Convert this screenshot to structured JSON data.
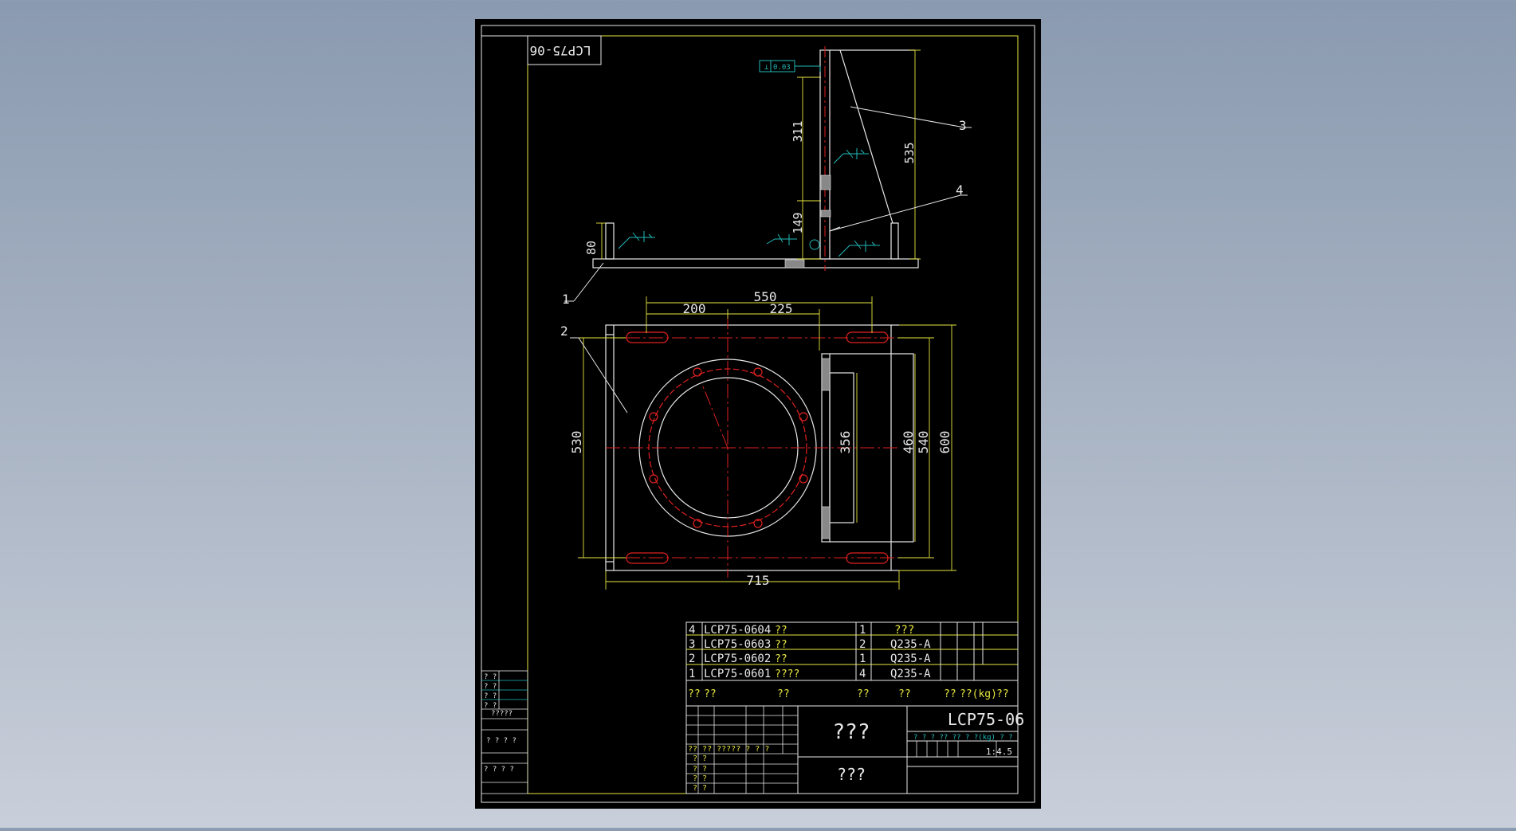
{
  "drawing": {
    "title_rot": "LCP75-06",
    "dims": {
      "d311": "311",
      "d535": "535",
      "d149": "149",
      "d80": "80",
      "d550": "550",
      "d200": "200",
      "d225": "225",
      "d530": "530",
      "d356": "356",
      "d460": "460",
      "d540": "540",
      "d600": "600",
      "d715": "715"
    },
    "flatness": "0.03",
    "leaders": {
      "l1": "1",
      "l2": "2",
      "l3": "3",
      "l4": "4"
    },
    "bom": [
      {
        "no": "4",
        "code": "LCP75-0604",
        "qty": "1",
        "mat": "???"
      },
      {
        "no": "3",
        "code": "LCP75-0603",
        "qty": "2",
        "mat": "Q235-A"
      },
      {
        "no": "2",
        "code": "LCP75-0602",
        "qty": "1",
        "mat": "Q235-A"
      },
      {
        "no": "1",
        "code": "LCP75-0601",
        "qty": "4",
        "mat": "Q235-A"
      }
    ],
    "bom_code_overlay": [
      "??",
      "??",
      "??",
      "????"
    ],
    "bom_header": {
      "no": "??",
      "code": "??",
      "name": "??",
      "qty": "??",
      "mat": "??",
      "wt": "??",
      "wt2": "??(kg)",
      "note": "??"
    },
    "title_block": {
      "name": "???",
      "company": "???",
      "drawing_no": "LCP75-06",
      "scale": "1:4.5",
      "dots": "? ? ? ?? ?? ? ?(kg) ? ?"
    },
    "side_table": [
      "? ?",
      "? ?",
      "? ?",
      "? ?",
      "?????",
      "? ? ? ?",
      "? ? ?  ?"
    ],
    "sign_rows": [
      "?? ??  ?????  ?  ? ?",
      "? ?",
      "? ?",
      "? ?",
      "? ?"
    ]
  }
}
